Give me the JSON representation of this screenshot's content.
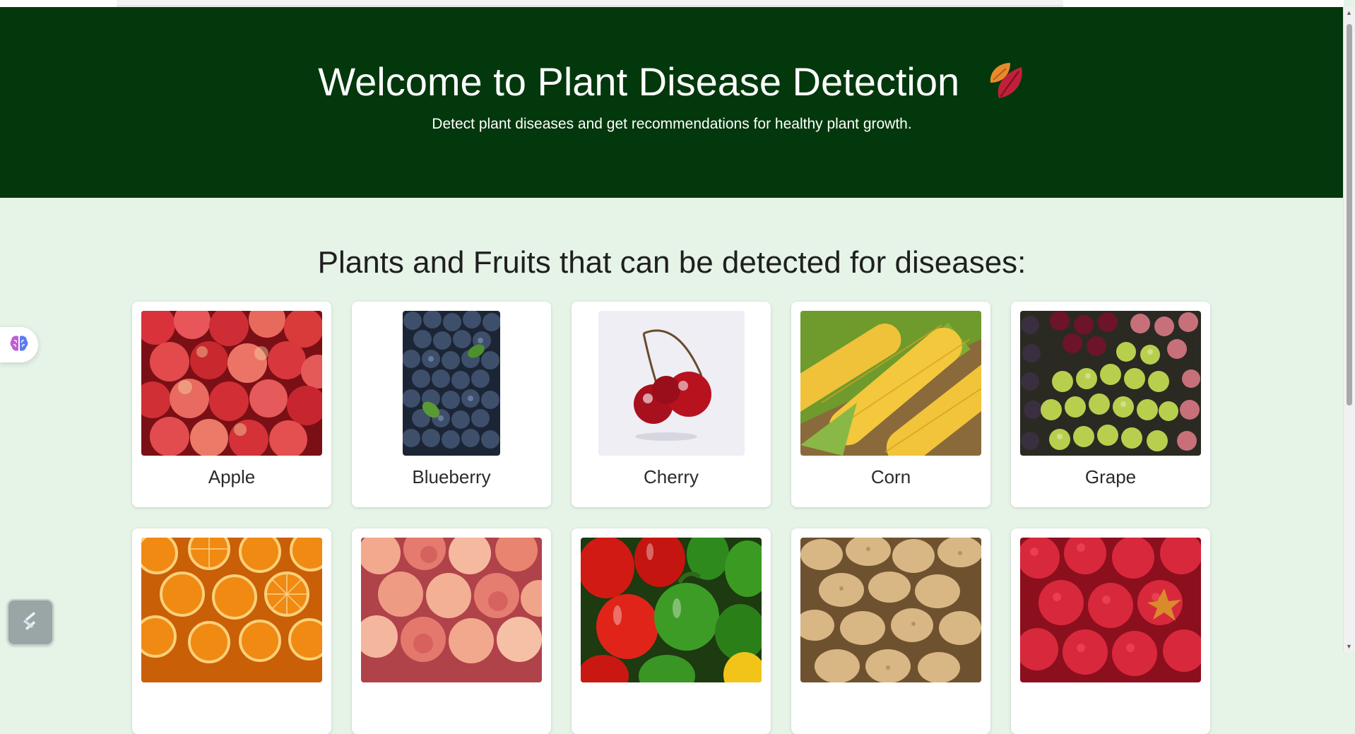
{
  "hero": {
    "title": "Welcome to Plant Disease Detection",
    "subtitle": "Detect plant diseases and get recommendations for healthy plant growth.",
    "icon": "fallen-leaf-icon",
    "background": "#02380c"
  },
  "section": {
    "title": "Plants and Fruits that can be detected for diseases:"
  },
  "plants": [
    {
      "label": "Apple"
    },
    {
      "label": "Blueberry"
    },
    {
      "label": "Cherry"
    },
    {
      "label": "Corn"
    },
    {
      "label": "Grape"
    },
    {
      "label": ""
    },
    {
      "label": ""
    },
    {
      "label": ""
    },
    {
      "label": ""
    },
    {
      "label": ""
    }
  ],
  "widgets": {
    "side": "brain-icon",
    "corner": "extension-icon"
  }
}
